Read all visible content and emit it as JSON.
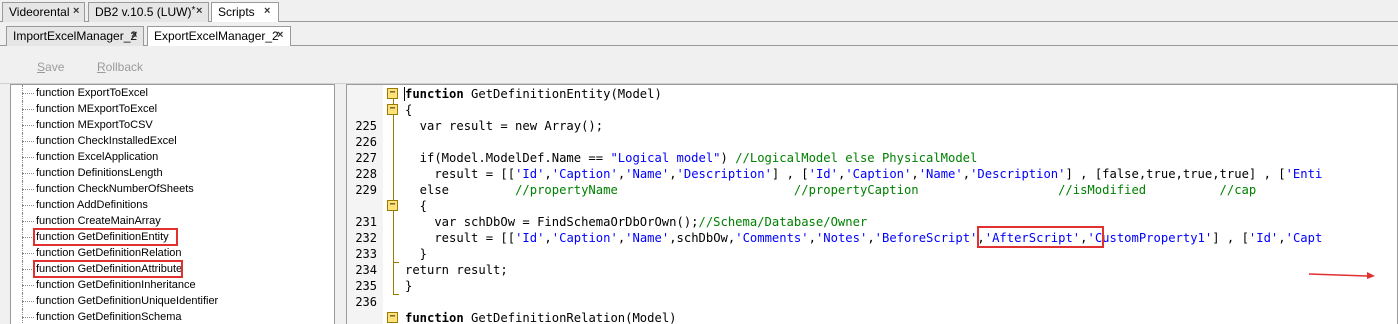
{
  "top_tabs": [
    {
      "label": "Videorental",
      "close": "×"
    },
    {
      "label": "DB2 v.10.5 (LUW)",
      "dirty": "*",
      "close": "×"
    },
    {
      "label": "Scripts",
      "close": "×"
    }
  ],
  "second_tabs": [
    {
      "label": "ImportExcelManager_2",
      "close": "×"
    },
    {
      "label": "ExportExcelManager_2",
      "close": "×"
    }
  ],
  "toolbar": {
    "save_first": "S",
    "save_rest": "ave",
    "rollback_first": "R",
    "rollback_rest": "ollback"
  },
  "tree": {
    "items": [
      "function ExportToExcel",
      "function MExportToExcel",
      "function MExportToCSV",
      "function CheckInstalledExcel",
      "function ExcelApplication",
      "function DefinitionsLength",
      "function CheckNumberOfSheets",
      "function AddDefinitions",
      "function CreateMainArray",
      "function GetDefinitionEntity",
      "function GetDefinitionRelation",
      "function GetDefinitionAttribute",
      "function GetDefinitionInheritance",
      "function GetDefinitionUniqueIdentifier",
      "function GetDefinitionSchema"
    ]
  },
  "editor": {
    "line_numbers": [
      "",
      "",
      "225",
      "226",
      "227",
      "228",
      "229",
      "",
      "231",
      "232",
      "233",
      "234",
      "235",
      "236",
      ""
    ],
    "fold_markers": [
      "−",
      "−",
      "−",
      "−"
    ],
    "lines": {
      "l0_kw": "function",
      "l0_rest": " GetDefinitionEntity(Model)",
      "l1": "{",
      "l2": "  var result = new Array();",
      "l3": "",
      "l4_a": "  if(Model.ModelDef.Name == ",
      "l4_str": "\"Logical model\"",
      "l4_b": ") ",
      "l4_cmt": "//LogicalModel else PhysicalModel",
      "l5_a": "    result = [[",
      "l5_s1": "'Id'",
      "l5_c1": ",",
      "l5_s2": "'Caption'",
      "l5_c2": ",",
      "l5_s3": "'Name'",
      "l5_c3": ",",
      "l5_s4": "'Description'",
      "l5_b": "] , [",
      "l5_s5": "'Id'",
      "l5_c5": ",",
      "l5_s6": "'Caption'",
      "l5_c6": ",",
      "l5_s7": "'Name'",
      "l5_c7": ",",
      "l5_s8": "'Description'",
      "l5_d": "] , [false,true,true,true] , [",
      "l5_s9": "'Enti",
      "l6_a": "  else         ",
      "l6_c1": "//propertyName",
      "l6_sp1": "                        ",
      "l6_c2": "//propertyCaption",
      "l6_sp2": "                   ",
      "l6_c3": "//isModified",
      "l6_sp3": "          ",
      "l6_c4": "//cap",
      "l7": "  {",
      "l8_a": "    var schDbOw = FindSchemaOrDbOrOwn();",
      "l8_cmt": "//Schema/Database/Owner",
      "l9_a": "    result = [[",
      "l9_s1": "'Id'",
      "l9_c1": ",",
      "l9_s2": "'Caption'",
      "l9_c2": ",",
      "l9_s3": "'Name'",
      "l9_c3": ",schDbOw,",
      "l9_s4": "'Comments'",
      "l9_c4": ",",
      "l9_s5": "'Notes'",
      "l9_c5": ",",
      "l9_s6": "'BeforeScript'",
      "l9_c6": ",",
      "l9_s7": "'AfterScript'",
      "l9_c7": ",",
      "l9_s8": "'CustomProperty1'",
      "l9_b": "] , [",
      "l9_s9": "'Id'",
      "l9_c9": ",",
      "l9_s10": "'Capt",
      "l10": "  }",
      "l11": "return result;",
      "l12": "}",
      "l13": "",
      "l14_kw": "function",
      "l14_rest": " GetDefinitionRelation(Model)"
    }
  },
  "colors": {
    "keyword": "#000000",
    "string": "#0000ff",
    "comment": "#008000",
    "highlight_box": "#e03030",
    "fold_marker": "#ffe27a"
  }
}
